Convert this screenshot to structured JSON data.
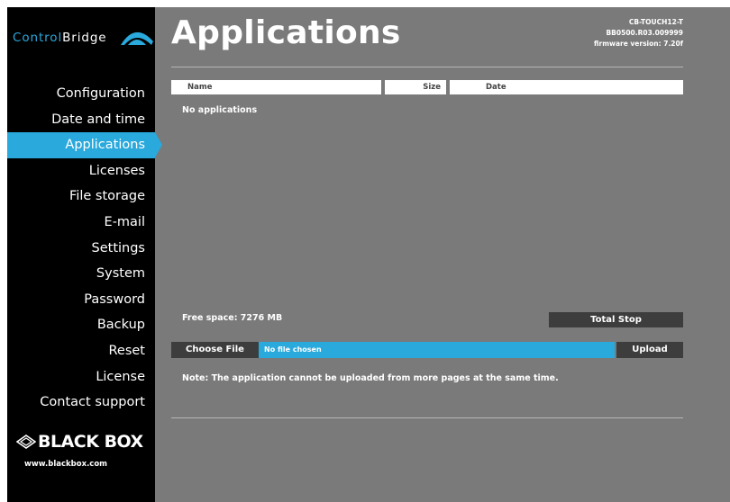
{
  "brand": {
    "part1": "Control",
    "part2": "Bridge",
    "vendor_logo": "BLACK BOX",
    "vendor_url": "www.blackbox.com"
  },
  "sidebar": {
    "items": [
      {
        "label": "Configuration",
        "active": false
      },
      {
        "label": "Date and time",
        "active": false
      },
      {
        "label": "Applications",
        "active": true
      },
      {
        "label": "Licenses",
        "active": false
      },
      {
        "label": "File storage",
        "active": false
      },
      {
        "label": "E-mail",
        "active": false
      },
      {
        "label": "Settings",
        "active": false
      },
      {
        "label": "System",
        "active": false
      },
      {
        "label": "Password",
        "active": false
      },
      {
        "label": "Backup",
        "active": false
      },
      {
        "label": "Reset",
        "active": false
      },
      {
        "label": "License",
        "active": false
      },
      {
        "label": "Contact support",
        "active": false
      }
    ]
  },
  "header": {
    "title": "Applications",
    "device_model": "CB-TOUCH12-T",
    "serial": "BB0500.R03.009999",
    "firmware": "firmware version: 7.20f"
  },
  "table": {
    "columns": [
      "Name",
      "Size",
      "Date"
    ],
    "empty_message": "No applications"
  },
  "storage": {
    "free_space_label": "Free space: 7276 MB"
  },
  "actions": {
    "total_stop": "Total Stop",
    "choose_file": "Choose File",
    "file_status": "No file chosen",
    "upload": "Upload"
  },
  "note": "Note: The application cannot be uploaded from more pages at the same time.",
  "colors": {
    "accent": "#2aa9dc",
    "background": "#7a7a7a",
    "sidebar": "#000000",
    "button": "#3d3d3d"
  }
}
